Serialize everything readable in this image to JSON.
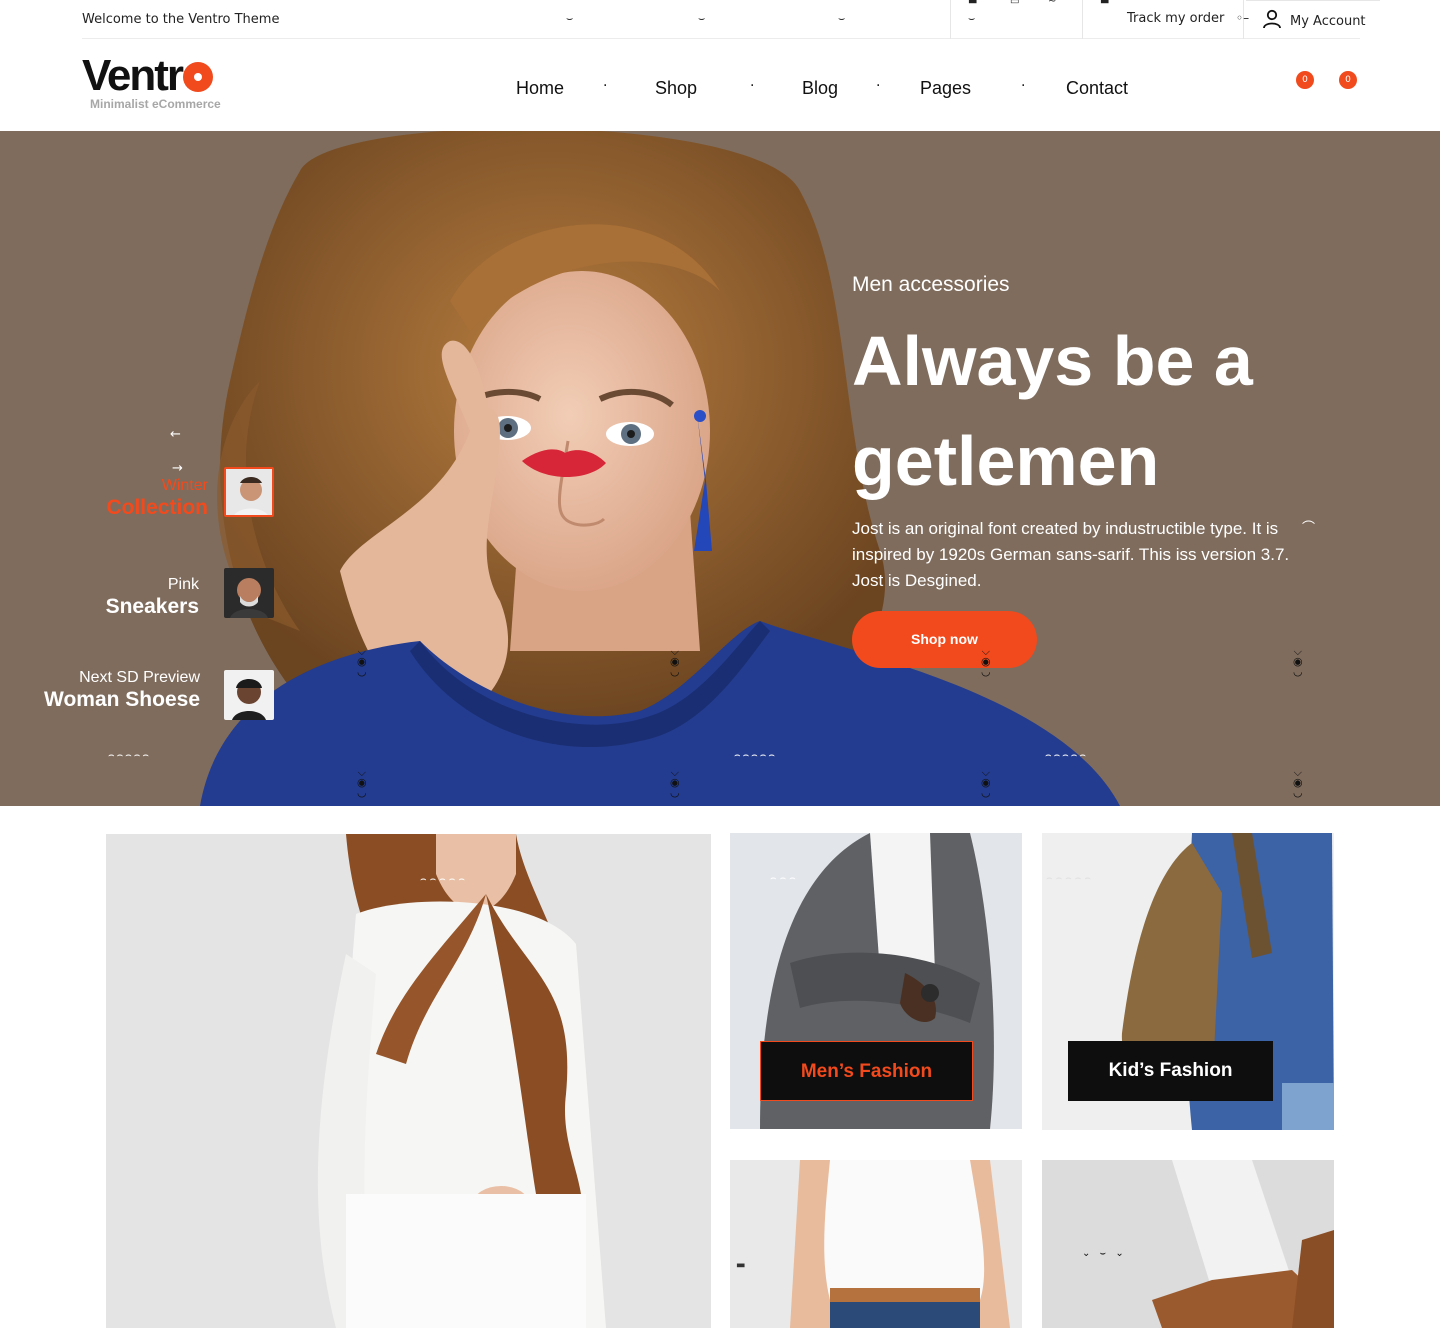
{
  "topbar": {
    "welcome": "Welcome to the Ventro Theme",
    "track_order": "Track my order",
    "my_account": "My Account"
  },
  "header": {
    "logo_text": "Ventr",
    "logo_tagline": "Minimalist eCommerce",
    "nav": [
      "Home",
      "Shop",
      "Blog",
      "Pages",
      "Contact"
    ],
    "wishlist_count": "0",
    "cart_count": "0"
  },
  "hero": {
    "kicker": "Men accessories",
    "title": "Always be  a getlemen",
    "text": "Jost is an original font created by industructible type. It is inspired by 1920s German sans-sarif. This iss version 3.7. Jost is Desgined.",
    "button": "Shop now",
    "slides": [
      {
        "top": "Winter",
        "bottom": "Collection",
        "active": true
      },
      {
        "top": "Pink",
        "bottom": "Sneakers",
        "active": false
      },
      {
        "top": "Next SD Preview",
        "bottom": "Woman Shoese",
        "active": false
      }
    ]
  },
  "banners": {
    "mens": "Men’s Fashion",
    "kids": "Kid’s Fashion"
  },
  "colors": {
    "accent": "#f24a1c",
    "hero_bg": "#7f6c5d",
    "label_bg": "#0e0e0e"
  }
}
